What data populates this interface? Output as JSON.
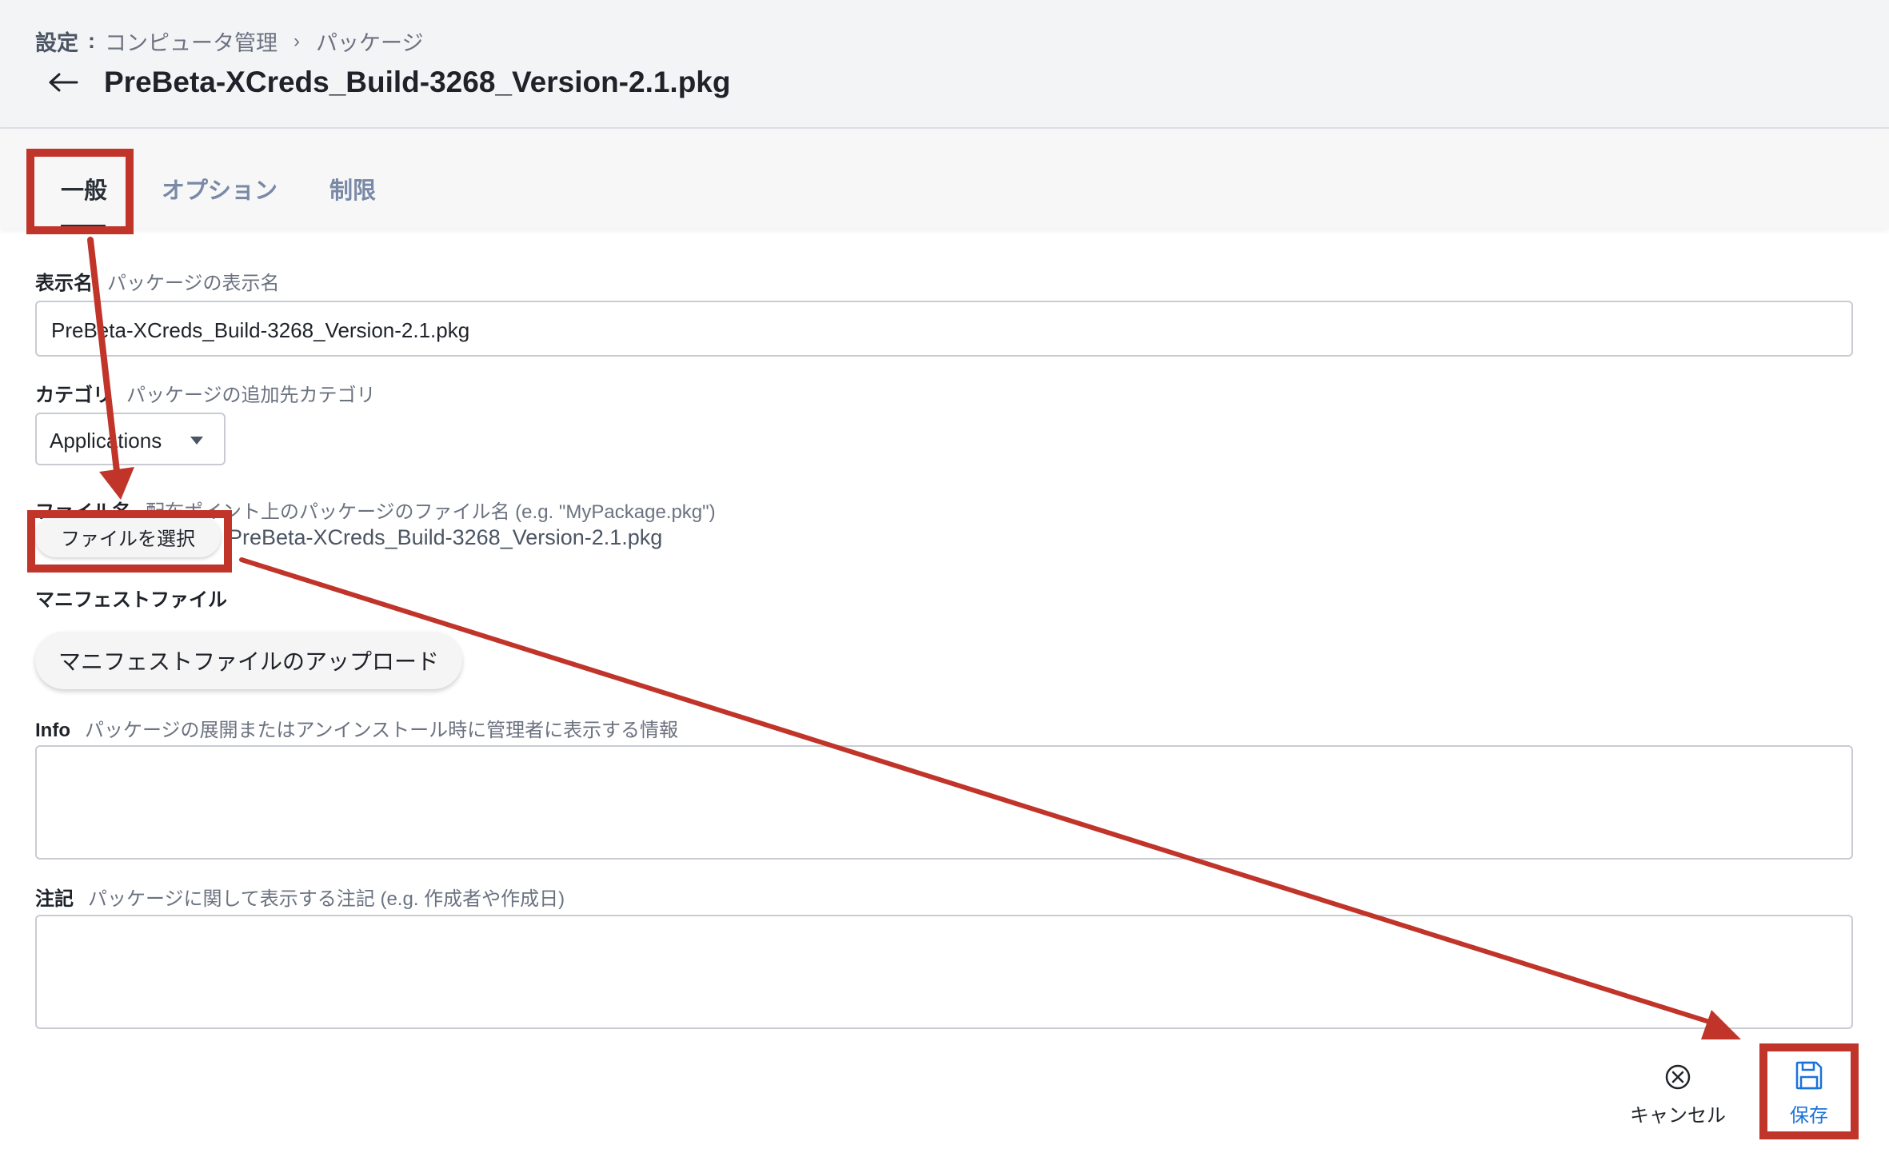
{
  "breadcrumb": {
    "root": "設定",
    "separator": ":",
    "section": "コンピュータ管理",
    "current": "パッケージ"
  },
  "header": {
    "title": "PreBeta-XCreds_Build-3268_Version-2.1.pkg",
    "back_icon": "arrow-left-icon"
  },
  "tabs": [
    {
      "label": "一般",
      "active": true
    },
    {
      "label": "オプション",
      "active": false
    },
    {
      "label": "制限",
      "active": false
    }
  ],
  "form": {
    "display_name": {
      "label": "表示名",
      "hint": "パッケージの表示名",
      "value": "PreBeta-XCreds_Build-3268_Version-2.1.pkg"
    },
    "category": {
      "label": "カテゴリ",
      "hint": "パッケージの追加先カテゴリ",
      "value": "Applications"
    },
    "filename": {
      "label": "ファイル名",
      "hint": "配布ポイント上のパッケージのファイル名 (e.g. \"MyPackage.pkg\")",
      "button": "ファイルを選択",
      "value": "PreBeta-XCreds_Build-3268_Version-2.1.pkg"
    },
    "manifest": {
      "label": "マニフェストファイル",
      "button": "マニフェストファイルのアップロード"
    },
    "info": {
      "label": "Info",
      "hint": "パッケージの展開またはアンインストール時に管理者に表示する情報",
      "value": ""
    },
    "notes": {
      "label": "注記",
      "hint": "パッケージに関して表示する注記 (e.g. 作成者や作成日)",
      "value": ""
    }
  },
  "actions": {
    "cancel": {
      "label": "キャンセル",
      "icon": "close-circle-icon"
    },
    "save": {
      "label": "保存",
      "icon": "save-icon"
    }
  },
  "colors": {
    "accent": "#1a73d9",
    "annotation": "#c0342a"
  }
}
